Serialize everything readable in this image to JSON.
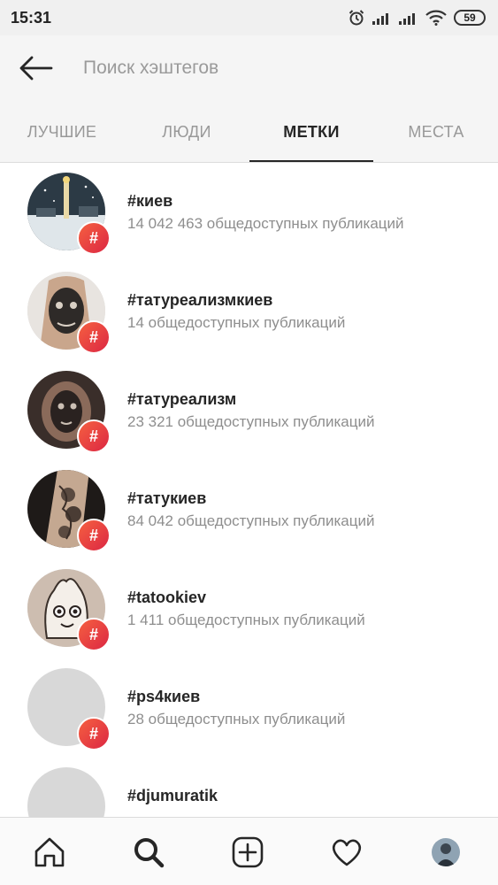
{
  "status_bar": {
    "time": "15:31",
    "battery": "59",
    "icons": [
      "alarm-icon",
      "signal-icon",
      "signal-icon",
      "wifi-icon",
      "battery-icon"
    ]
  },
  "search": {
    "placeholder": "Поиск хэштегов",
    "value": "",
    "back_icon": "arrow-left-icon"
  },
  "tabs": [
    {
      "label": "ЛУЧШИЕ",
      "active": false
    },
    {
      "label": "ЛЮДИ",
      "active": false
    },
    {
      "label": "МЕТКИ",
      "active": true
    },
    {
      "label": "МЕСТА",
      "active": false
    }
  ],
  "results": [
    {
      "tag": "#киев",
      "count": "14 042 463 общедоступных публикаций",
      "badge": "#"
    },
    {
      "tag": "#татуреализмкиев",
      "count": "14 общедоступных публикаций",
      "badge": "#"
    },
    {
      "tag": "#татуреализм",
      "count": "23 321 общедоступных публикаций",
      "badge": "#"
    },
    {
      "tag": "#татукиев",
      "count": "84 042 общедоступных публикаций",
      "badge": "#"
    },
    {
      "tag": "#tatookiev",
      "count": "1 411 общедоступных публикаций",
      "badge": "#"
    },
    {
      "tag": "#ps4киев",
      "count": "28 общедоступных публикаций",
      "badge": "#"
    },
    {
      "tag": "#djumuratik",
      "count": "",
      "badge": ""
    }
  ],
  "bottom_nav": [
    {
      "icon": "home-icon"
    },
    {
      "icon": "search-icon",
      "active": true
    },
    {
      "icon": "add-post-icon"
    },
    {
      "icon": "heart-icon"
    },
    {
      "icon": "profile-avatar"
    }
  ],
  "colors": {
    "badge_start": "#f56040",
    "badge_end": "#dc2743",
    "active_tab": "#262626",
    "inactive_tab": "#999999",
    "secondary_text": "#8e8e8e"
  }
}
